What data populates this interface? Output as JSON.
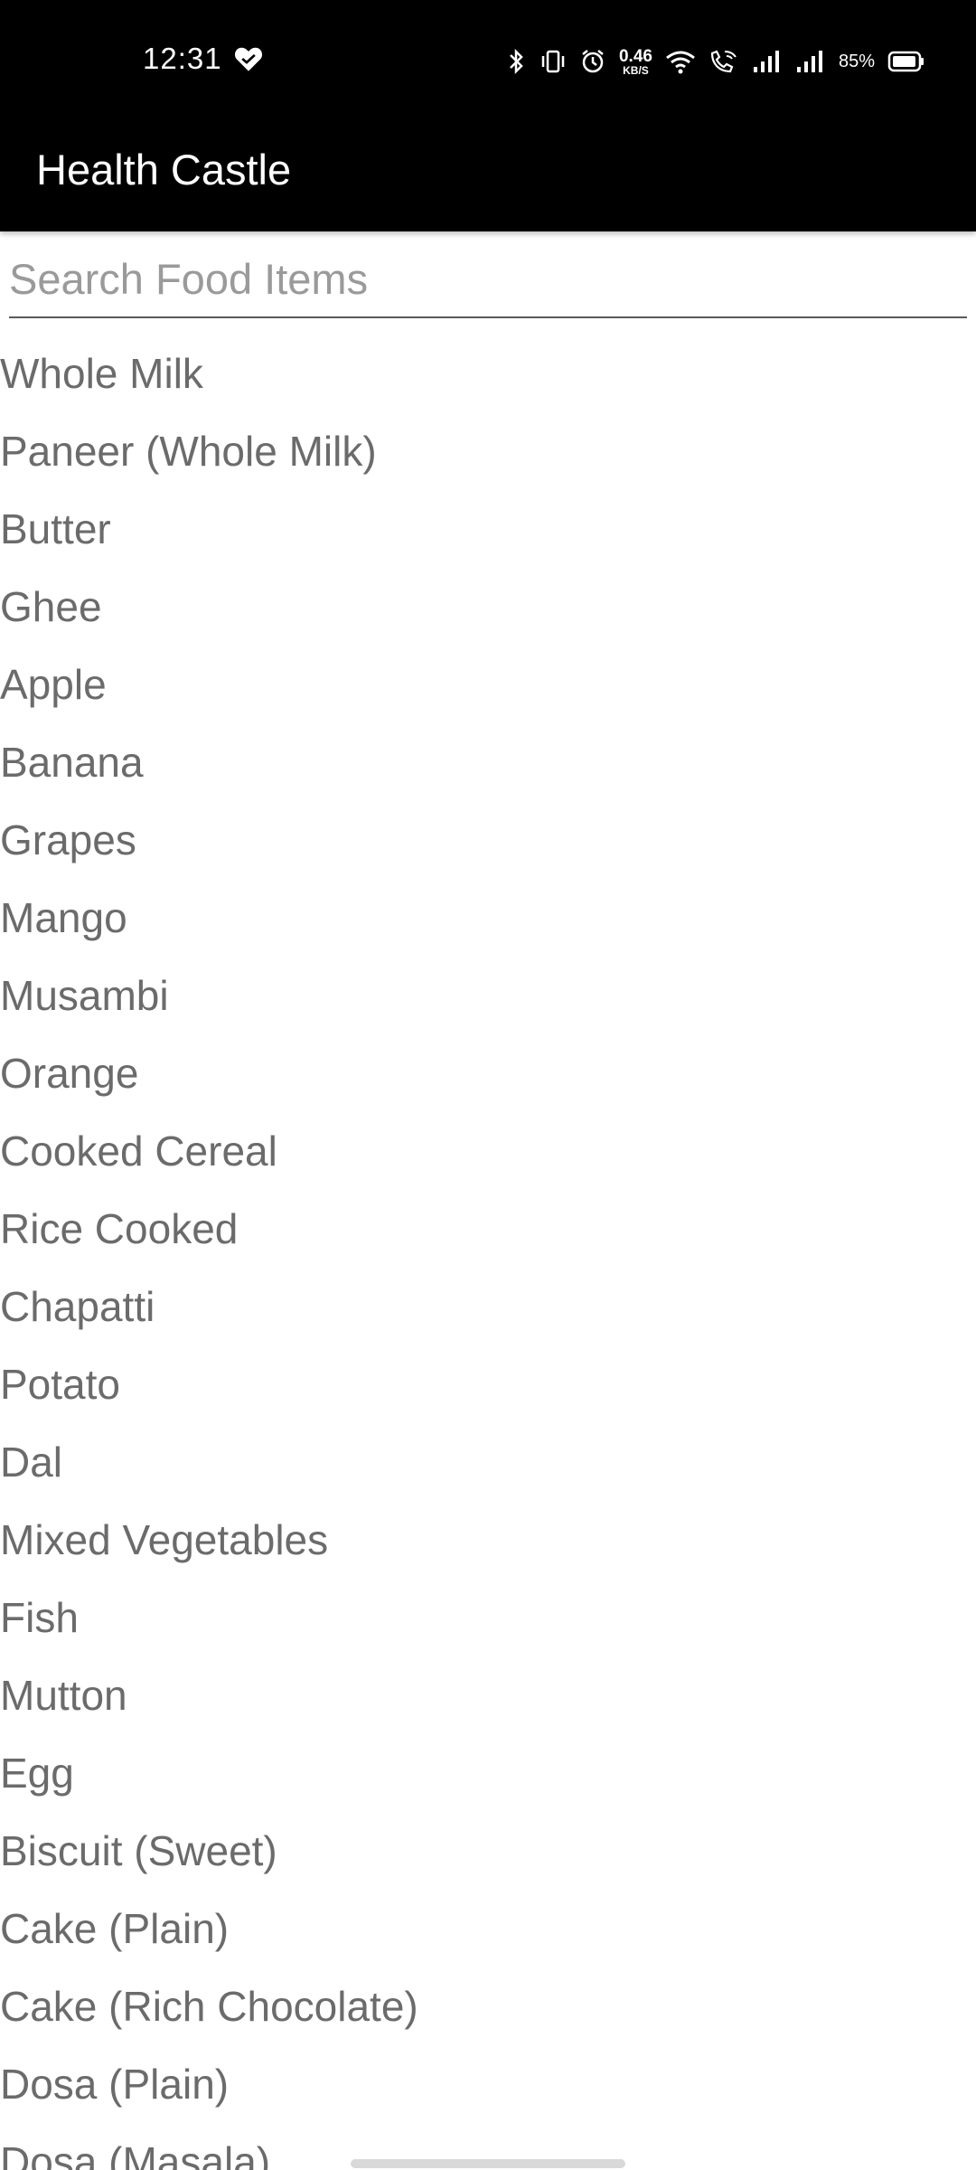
{
  "status_bar": {
    "time": "12:31",
    "net_speed_value": "0.46",
    "net_speed_unit": "KB/S",
    "battery": "85%",
    "icons": [
      "heart-icon",
      "bluetooth-icon",
      "vibrate-icon",
      "alarm-icon",
      "wifi-icon",
      "wifi-calling-icon",
      "signal-icon",
      "signal-icon",
      "battery-icon"
    ]
  },
  "app_bar": {
    "title": "Health Castle"
  },
  "search": {
    "placeholder": "Search Food Items",
    "value": ""
  },
  "food_items": [
    "Whole Milk",
    "Paneer (Whole Milk)",
    "Butter",
    "Ghee",
    "Apple",
    "Banana",
    "Grapes",
    "Mango",
    "Musambi",
    "Orange",
    "Cooked Cereal",
    "Rice Cooked",
    "Chapatti",
    "Potato",
    "Dal",
    "Mixed Vegetables",
    "Fish",
    "Mutton",
    "Egg",
    "Biscuit (Sweet)",
    "Cake (Plain)",
    "Cake (Rich Chocolate)",
    "Dosa (Plain)",
    "Dosa (Masala)"
  ],
  "colors": {
    "app_bar_bg": "#000000",
    "title_text": "#ffffff",
    "item_text": "#6b6b6b",
    "placeholder_text": "#9a9a9a"
  }
}
